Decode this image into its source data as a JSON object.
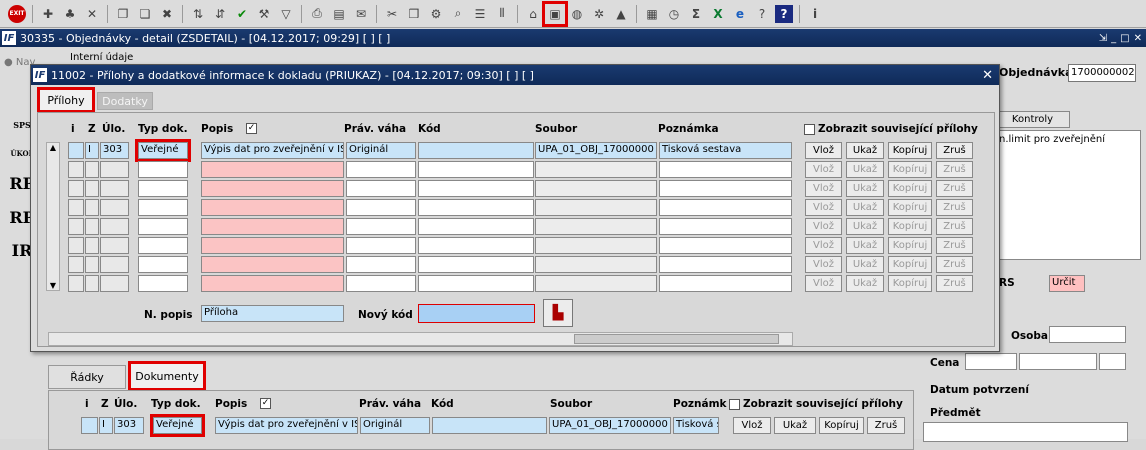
{
  "main_window": {
    "title": "30335 - Objednávky - detail (ZSDETAIL) - [04.12.2017; 09:29]  [ ]  [ ]",
    "logo": "IF",
    "nav_label": "Nav",
    "interni_udaje": "Interní údaje",
    "objednavka_label": "Objednávka",
    "objednavka_value": "1700000002",
    "kontroly_tab": "Kontroly",
    "right_text": "n.limit pro zveřejnění",
    "rs_label": "RS",
    "urcit_value": "Určit",
    "osoba_label": "Osoba",
    "cena_label": "Cena",
    "datum_label": "Datum potvrzení",
    "predmet_label": "Předmět",
    "side_icons": [
      "SPS",
      "ÚKOL",
      "RP",
      "RP",
      "IR"
    ]
  },
  "toolbar": {
    "exit_label": "EXIT",
    "icons": [
      "new-icon",
      "tree-icon",
      "disabled-icon",
      "copy-icon",
      "copy-icon",
      "delete-icon",
      "sort-icon",
      "sort-icon",
      "check-icon",
      "wrench-icon",
      "filter-icon",
      "print-icon",
      "print-preview-icon",
      "mail-icon",
      "cut-icon",
      "paste-icon",
      "tool-icon",
      "find-icon",
      "list-icon",
      "columns-icon",
      "desk-icon",
      "attachment-icon",
      "globe-icon",
      "gear-icon",
      "mountain-icon",
      "report-icon",
      "clock-icon",
      "sigma-icon",
      "excel-icon",
      "ie-icon",
      "help-icon",
      "info-icon"
    ]
  },
  "dialog": {
    "title": "11002 - Přílohy a dodatkové informace k dokladu (PRIUKAZ) - [04.12.2017; 09:30]  [ ]  [ ]",
    "logo": "IF",
    "close": "✕",
    "tabs": {
      "prilohy": "Přílohy",
      "dodatky": "Dodatky"
    },
    "headers": {
      "i": "i",
      "z": "Z",
      "ulo": "Úlo.",
      "typ": "Typ dok.",
      "popis": "Popis",
      "prav": "Práv. váha",
      "kod": "Kód",
      "soubor": "Soubor",
      "poznamka": "Poznámka",
      "zobrazit": "Zobrazit související přílohy"
    },
    "row": {
      "z": "I",
      "ulo": "303",
      "typ": "Veřejné",
      "popis": "Výpis dat pro zveřejnění v IS",
      "prav": "Originál",
      "kod": "",
      "soubor": "UPA_01_OBJ_17000000",
      "poznamka": "Tisková sestava"
    },
    "buttons": {
      "vloz": "Vlož",
      "ukaz": "Ukaž",
      "kopiruj": "Kopíruj",
      "zrus": "Zruš"
    },
    "n_popis_label": "N. popis",
    "n_popis_value": "Příloha",
    "novy_kod_label": "Nový kód"
  },
  "bottom": {
    "tabs": {
      "radky": "Řádky",
      "dokumenty": "Dokumenty"
    },
    "headers": {
      "i": "i",
      "z": "Z",
      "ulo": "Úlo.",
      "typ": "Typ dok.",
      "popis": "Popis",
      "prav": "Práv. váha",
      "kod": "Kód",
      "soubor": "Soubor",
      "poznamka": "Poznámk",
      "zobrazit": "Zobrazit související přílohy"
    },
    "row": {
      "z": "I",
      "ulo": "303",
      "typ": "Veřejné",
      "popis": "Výpis dat pro zveřejnění v IS",
      "prav": "Originál",
      "kod": "",
      "soubor": "UPA_01_OBJ_17000000",
      "poznamka": "Tisková s"
    },
    "buttons": {
      "vloz": "Vlož",
      "ukaz": "Ukaž",
      "kopiruj": "Kopíruj",
      "zrus": "Zruš"
    }
  }
}
